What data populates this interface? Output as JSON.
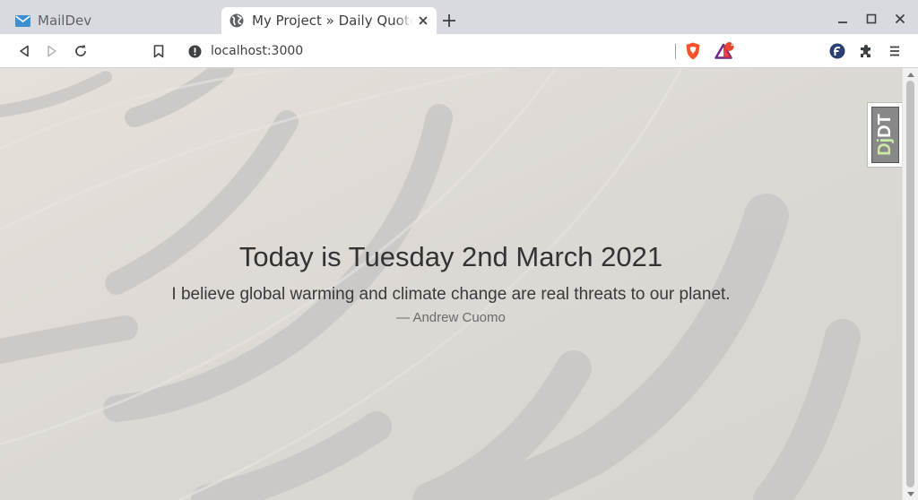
{
  "tabs": [
    {
      "title": "MailDev",
      "active": false,
      "icon": "mail-icon"
    },
    {
      "title": "My Project » Daily Quote",
      "active": true,
      "icon": "globe-icon"
    }
  ],
  "toolbar": {
    "url": "localhost:3000",
    "brave_rewards_badge": "1"
  },
  "page": {
    "headline": "Today is Tuesday 2nd March 2021",
    "quote": "I believe global warming and climate change are real threats to our planet.",
    "author": "— Andrew Cuomo"
  },
  "debug_toolbar": {
    "label_dj": "Dj",
    "label_dt": "DT"
  },
  "colors": {
    "mail_icon": "#3d8fd1",
    "brave_orange": "#fb542b",
    "accent_fedora": "#294172",
    "djdt_green": "#c9e9a4"
  }
}
